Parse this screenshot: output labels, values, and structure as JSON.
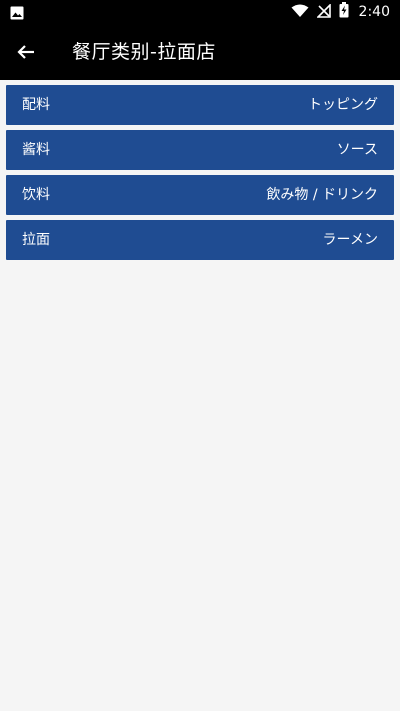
{
  "status_bar": {
    "time": "2:40",
    "left_icon": "image-notification-icon",
    "right_icons": [
      "wifi-icon",
      "no-signal-icon",
      "battery-charging-icon"
    ]
  },
  "toolbar": {
    "back_icon": "arrow-back-icon",
    "title": "餐厅类别-拉面店"
  },
  "categories": [
    {
      "zh": "配料",
      "jp": "トッピング"
    },
    {
      "zh": "酱料",
      "jp": "ソース"
    },
    {
      "zh": "饮料",
      "jp": "飲み物 / ドリンク"
    },
    {
      "zh": "拉面",
      "jp": "ラーメン"
    }
  ],
  "colors": {
    "bar_bg": "#000000",
    "row_bg": "#1f4c92",
    "page_bg": "#f5f5f5",
    "text_light": "#ffffff"
  }
}
